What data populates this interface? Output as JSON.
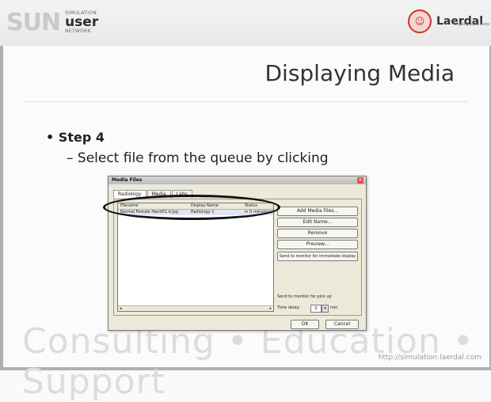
{
  "header": {
    "logo_letters": "SUN",
    "logo_tiny_top": "SIMULATION",
    "logo_user": "user",
    "logo_tiny_bottom": "NETWORK",
    "brand_name": "Laerdal",
    "brand_tagline": "helping save lives"
  },
  "slide": {
    "title": "Displaying Media",
    "bullet": "Step 4",
    "sub_bullet": "– Select file from the queue by clicking"
  },
  "dialog": {
    "title": "Media Files",
    "tabs": [
      "Radiology",
      "Media",
      "Labs"
    ],
    "columns": [
      "Filename",
      "Display Name",
      "Status"
    ],
    "rows": [
      {
        "filename": "Normal Female Hand01.d.jpg",
        "display_name": "Radiology 1",
        "status": "in 0 minute(s)"
      }
    ],
    "buttons": [
      "Add Media Files...",
      "Edit Name...",
      "Remove",
      "Preview...",
      "Send to monitor for immediate display"
    ],
    "send_label": "Send to monitor for pick up",
    "delay_label": "Time delay:",
    "delay_value": "0",
    "delay_unit": "min",
    "ok_label": "OK",
    "cancel_label": "Cancel"
  },
  "watermark": {
    "text": "Consulting  •  Education  •  Support"
  },
  "footer": {
    "url": "http://simulation.laerdal.com"
  },
  "colors": {
    "highlight_ellipse": "#111111",
    "laerdal_red": "#c0392b"
  }
}
